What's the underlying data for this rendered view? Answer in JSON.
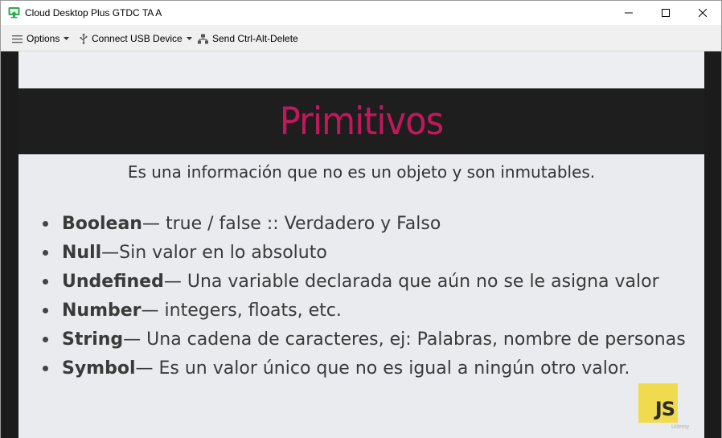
{
  "window": {
    "title": "Cloud Desktop Plus GTDC TA A",
    "icon": "cloud-desktop-icon"
  },
  "toolbar": {
    "options_label": "Options",
    "usb_label": "Connect USB Device",
    "send_label": "Send Ctrl-Alt-Delete"
  },
  "slide": {
    "title": "Primitivos",
    "subtitle": "Es una información que no es un objeto y son inmutables.",
    "items": [
      {
        "term": "Boolean",
        "desc": " — true / false :: Verdadero y Falso"
      },
      {
        "term": "Null",
        "desc": " —Sin valor en lo absoluto"
      },
      {
        "term": "Undefined",
        "desc": " — Una variable declarada que aún no se le asigna valor"
      },
      {
        "term": "Number",
        "desc": " — integers, floats, etc."
      },
      {
        "term": "String",
        "desc": " — Una cadena de caracteres, ej: Palabras, nombre de personas"
      },
      {
        "term": "Symbol",
        "desc": " — Es un valor único que no es igual a ningún otro valor."
      }
    ],
    "logo_text": "JS",
    "watermark": "Udemy"
  },
  "colors": {
    "title_accent": "#c2185b",
    "js_yellow": "#f0db4f",
    "band": "#1e1e1e"
  }
}
